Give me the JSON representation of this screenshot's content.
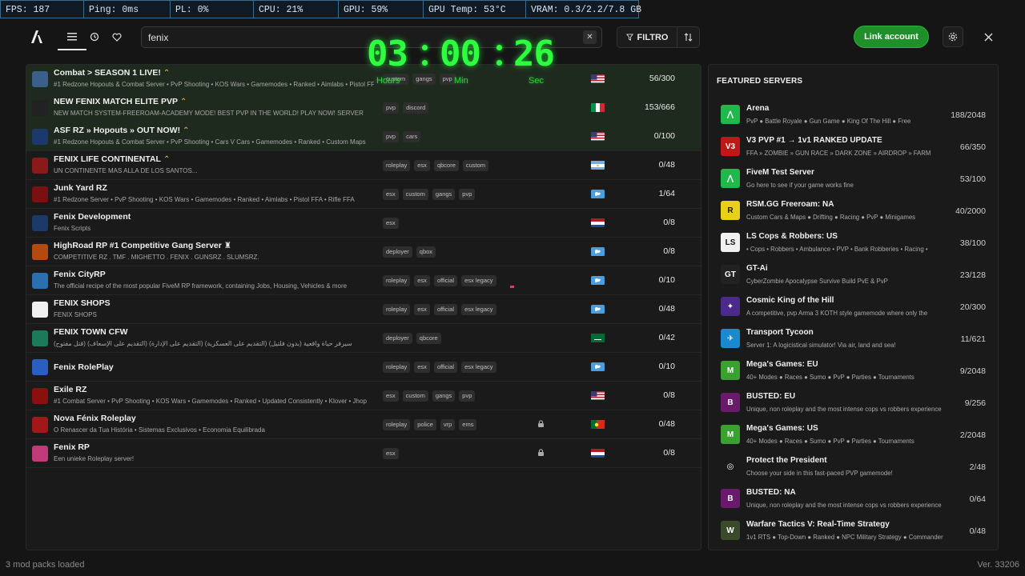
{
  "stats": [
    "FPS: 187",
    "Ping: 0ms",
    "PL: 0%",
    "CPU: 21%",
    "GPU: 59%",
    "GPU Temp: 53°C",
    "VRAM: 0.3/2.2/7.8 GB"
  ],
  "ghost_fps": "187fps",
  "search": {
    "value": "fenix"
  },
  "toolbar": {
    "filter_label": "FILTRO",
    "link_account_label": "Link account"
  },
  "timer": {
    "hours": "03",
    "minutes": "00",
    "seconds": "26",
    "hours_label": "Hours",
    "minutes_label": "Min",
    "seconds_label": "Sec"
  },
  "servers": [
    {
      "name": "Combat > SEASON 1 LIVE!",
      "boost": true,
      "desc": "#1 Redzone Hopouts & Combat Server • PvP Shooting • KOS Wars • Gamemodes • Ranked • Aimlabs • Pistol FFA",
      "tags": [
        "custom",
        "gangs",
        "pvp"
      ],
      "flag": "us",
      "players": "56/300",
      "promo": true,
      "icon_color": "#3a5f8a"
    },
    {
      "name": "NEW FENIX MATCH ELITE PVP",
      "boost": true,
      "desc": "NEW MATCH SYSTEM-FREEROAM-ACADEMY MODE! BEST PVP IN THE WORLD! PLAY NOW! SERVER",
      "tags": [
        "pvp",
        "discord"
      ],
      "flag": "it",
      "players": "153/666",
      "promo": true,
      "icon_color": "#222"
    },
    {
      "name": "ASF RZ » Hopouts » OUT NOW!",
      "boost": true,
      "desc": "#1 Redzone Hopouts & Combat Server • PvP Shooting • Cars V Cars • Gamemodes • Ranked • Custom Maps",
      "tags": [
        "pvp",
        "cars"
      ],
      "flag": "us",
      "players": "0/100",
      "promo": true,
      "icon_color": "#1b3a6b"
    },
    {
      "name": "FENIX LIFE CONTINENTAL",
      "boost": true,
      "desc": "UN CONTINENTE MAS ALLA DE LOS SANTOS...",
      "tags": [
        "roleplay",
        "esx",
        "qbcore",
        "custom"
      ],
      "flag": "ar",
      "players": "0/48",
      "promo": false,
      "icon_color": "#8a1a1a"
    },
    {
      "name": "Junk Yard RZ",
      "boost": false,
      "desc": "#1 Redzone Server • PvP Shooting • KOS Wars • Gamemodes • Ranked • Aimlabs • Pistol FFA • Rifle FFA",
      "tags": [
        "esx",
        "custom",
        "gangs",
        "pvp"
      ],
      "flag": "world",
      "players": "1/64",
      "promo": false,
      "icon_color": "#7a1010"
    },
    {
      "name": "Fenix Development",
      "boost": false,
      "desc": "Fenix Scripts",
      "tags": [
        "esx"
      ],
      "flag": "nl",
      "players": "0/8",
      "promo": false,
      "icon_color": "#1a3a6a"
    },
    {
      "name": "HighRoad RP #1 Competitive Gang Server ♜",
      "boost": false,
      "desc": "COMPETITIVE RZ . TMF . MIGHETTO . FENIX . GUNSRZ . SLUMSRZ.",
      "tags": [
        "deployer",
        "qbox"
      ],
      "flag": "world",
      "players": "0/8",
      "promo": false,
      "icon_color": "#b34a10"
    },
    {
      "name": "Fenix CityRP",
      "boost": false,
      "desc": "The official recipe of the most popular FiveM RP framework, containing Jobs, Housing, Vehicles & more",
      "tags": [
        "roleplay",
        "esx",
        "official",
        "esx legacy"
      ],
      "flag": "world",
      "players": "0/10",
      "promo": false,
      "icon_color": "#2a6fb0"
    },
    {
      "name": "FENIX SHOPS",
      "boost": false,
      "desc": "FENIX SHOPS",
      "tags": [
        "roleplay",
        "esx",
        "official",
        "esx legacy"
      ],
      "flag": "world",
      "players": "0/48",
      "promo": false,
      "icon_color": "#f0f0f0"
    },
    {
      "name": "FENIX TOWN CFW",
      "boost": false,
      "desc": "سيرفر حياة واقعية (بدون فلتيل) (التقديم على العسكرية) (التقديم على الإدارة) (التقديم على الإسعاف) (قتل مفتوح)",
      "tags": [
        "deployer",
        "qbcore"
      ],
      "flag": "sa",
      "players": "0/42",
      "promo": false,
      "icon_color": "#1a7a5a"
    },
    {
      "name": "Fenix RolePlay",
      "boost": false,
      "desc": "",
      "tags": [
        "roleplay",
        "esx",
        "official",
        "esx legacy"
      ],
      "flag": "world",
      "players": "0/10",
      "promo": false,
      "icon_color": "#2a5fc0"
    },
    {
      "name": "Exile RZ",
      "boost": false,
      "desc": "#1 Combat Server • PvP Shooting • KOS Wars • Gamemodes • Ranked • Updated Consistently • Klover • Jhop",
      "tags": [
        "esx",
        "custom",
        "gangs",
        "pvp"
      ],
      "flag": "us",
      "players": "0/8",
      "promo": false,
      "icon_color": "#8a1010"
    },
    {
      "name": "Nova Fénix Roleplay",
      "boost": false,
      "desc": "O Renascer da Tua História • Sistemas Exclusivos • Economia Equilibrada",
      "tags": [
        "roleplay",
        "police",
        "vrp",
        "ems"
      ],
      "flag": "pt",
      "players": "0/48",
      "promo": false,
      "lock": true,
      "icon_color": "#a01818"
    },
    {
      "name": "Fenix RP",
      "boost": false,
      "desc": "Een unieke Roleplay server!",
      "tags": [
        "esx"
      ],
      "flag": "nl",
      "players": "0/8",
      "promo": false,
      "lock": true,
      "icon_color": "#c03a7a"
    }
  ],
  "featured": {
    "title": "FEATURED SERVERS",
    "items": [
      {
        "name": "Arena",
        "desc": "PvP ● Battle Royale ● Gun Game ● King Of The Hill ● Free",
        "players": "188/2048",
        "icon_bg": "#1fb84a",
        "icon_text": "⋀"
      },
      {
        "name": "V3 PVP #1 → 1v1 RANKED UPDATE",
        "desc": "FFA » ZOMBIE » GUN RACE » DARK ZONE » AIRDROP » FARM",
        "players": "66/350",
        "icon_bg": "#c01818",
        "icon_text": "V3"
      },
      {
        "name": "FiveM Test Server",
        "desc": "Go here to see if your game works fine",
        "players": "53/100",
        "icon_bg": "#1fb84a",
        "icon_text": "⋀"
      },
      {
        "name": "RSM.GG Freeroam: NA",
        "desc": "Custom Cars & Maps ● Drifting ● Racing ● PvP ● Minigames",
        "players": "40/2000",
        "icon_bg": "#e8d018",
        "icon_text": "R"
      },
      {
        "name": "LS Cops & Robbers: US",
        "desc": "• Cops • Robbers • Ambulance • PVP • Bank Robberies • Racing •",
        "players": "38/100",
        "icon_bg": "#f0f0f0",
        "icon_text": "LS"
      },
      {
        "name": "GT-Ai",
        "desc": "CyberZombie Apocalypse Survive Build PvE & PvP",
        "players": "23/128",
        "icon_bg": "#222",
        "icon_text": "GT"
      },
      {
        "name": "Cosmic King of the Hill",
        "desc": "A competitive, pvp Arma 3 KOTH style gamemode where only the",
        "players": "20/300",
        "icon_bg": "#4a2a8a",
        "icon_text": "✦"
      },
      {
        "name": "Transport Tycoon",
        "desc": "Server 1: A logicistical simulator! Via air, land and sea!",
        "players": "11/621",
        "icon_bg": "#1a8ad0",
        "icon_text": "✈"
      },
      {
        "name": "Mega's Games: EU",
        "desc": "40+ Modes ● Races ● Sumo ● PvP ● Parties ● Tournaments",
        "players": "9/2048",
        "icon_bg": "#3aa030",
        "icon_text": "M"
      },
      {
        "name": "BUSTED: EU",
        "desc": "Unique, non roleplay and the most intense cops vs robbers experience",
        "players": "9/256",
        "icon_bg": "#6a1a6a",
        "icon_text": "B"
      },
      {
        "name": "Mega's Games: US",
        "desc": "40+ Modes ● Races ● Sumo ● PvP ● Parties ● Tournaments",
        "players": "2/2048",
        "icon_bg": "#3aa030",
        "icon_text": "M"
      },
      {
        "name": "Protect the President",
        "desc": "Choose your side in this fast-paced PVP gamemode!",
        "players": "2/48",
        "icon_bg": "#1a1a1a",
        "icon_text": "◎"
      },
      {
        "name": "BUSTED: NA",
        "desc": "Unique, non roleplay and the most intense cops vs robbers experience",
        "players": "0/64",
        "icon_bg": "#6a1a6a",
        "icon_text": "B"
      },
      {
        "name": "Warfare Tactics V: Real-Time Strategy",
        "desc": "1v1 RTS ● Top-Down ● Ranked ● NPC Military Strategy ● Commander",
        "players": "0/48",
        "icon_bg": "#3a4a2a",
        "icon_text": "W"
      }
    ]
  },
  "footer": {
    "left": "3 mod packs loaded",
    "right": "Ver. 33206"
  }
}
